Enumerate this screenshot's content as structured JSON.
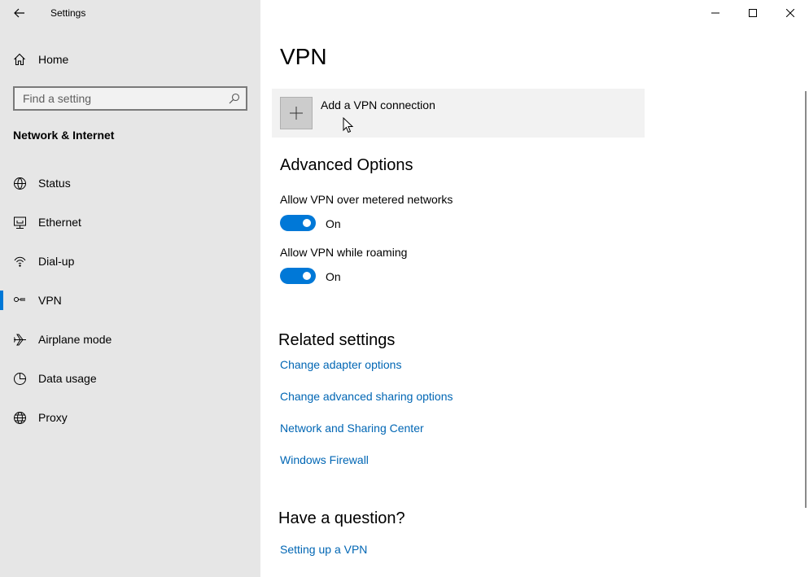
{
  "window": {
    "title": "Settings",
    "controls": [
      "minimize-icon",
      "maximize-icon",
      "close-icon"
    ]
  },
  "sidebar": {
    "home_label": "Home",
    "search": {
      "placeholder": "Find a setting",
      "value": ""
    },
    "section_title": "Network & Internet",
    "items": [
      {
        "label": "Status",
        "icon": "status-icon",
        "active": false
      },
      {
        "label": "Ethernet",
        "icon": "ethernet-icon",
        "active": false
      },
      {
        "label": "Dial-up",
        "icon": "dialup-icon",
        "active": false
      },
      {
        "label": "VPN",
        "icon": "vpn-icon",
        "active": true
      },
      {
        "label": "Airplane mode",
        "icon": "airplane-icon",
        "active": false
      },
      {
        "label": "Data usage",
        "icon": "data-usage-icon",
        "active": false
      },
      {
        "label": "Proxy",
        "icon": "globe-icon",
        "active": false
      }
    ]
  },
  "main": {
    "title": "VPN",
    "add_vpn_label": "Add a VPN connection",
    "advanced": {
      "heading": "Advanced Options",
      "options": [
        {
          "label": "Allow VPN over metered networks",
          "state": "On"
        },
        {
          "label": "Allow VPN while roaming",
          "state": "On"
        }
      ]
    },
    "related": {
      "heading": "Related settings",
      "links": [
        "Change adapter options",
        "Change advanced sharing options",
        "Network and Sharing Center",
        "Windows Firewall"
      ]
    },
    "question": {
      "heading": "Have a question?",
      "links": [
        "Setting up a VPN"
      ]
    }
  },
  "colors": {
    "accent": "#0078d7",
    "link": "#0066b4",
    "sidebar_bg": "#e6e6e6"
  }
}
